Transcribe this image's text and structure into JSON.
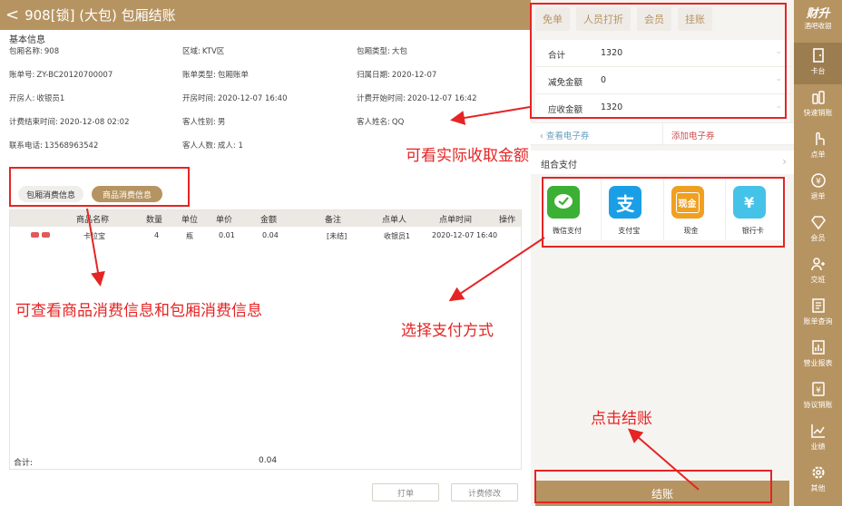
{
  "titlebar": {
    "back": "<",
    "title": "908[锁] (大包) 包厢结账"
  },
  "basic_info": {
    "section_title": "基本信息",
    "fields": [
      {
        "label": "包厢名称:",
        "value": "908"
      },
      {
        "label": "区域:",
        "value": "KTV区"
      },
      {
        "label": "包厢类型:",
        "value": "大包"
      },
      {
        "label": "账单号:",
        "value": "ZY-BC20120700007"
      },
      {
        "label": "账单类型:",
        "value": "包厢账单"
      },
      {
        "label": "归属日期:",
        "value": "2020-12-07"
      },
      {
        "label": "开房人:",
        "value": "收银员1"
      },
      {
        "label": "开房时间:",
        "value": "2020-12-07 16:40"
      },
      {
        "label": "计费开始时间:",
        "value": "2020-12-07 16:42"
      },
      {
        "label": "计费结束时间:",
        "value": "2020-12-08 02:02"
      },
      {
        "label": "客人性别:",
        "value": "男"
      },
      {
        "label": "客人姓名:",
        "value": "QQ"
      },
      {
        "label": "联系电话:",
        "value": "13568963542"
      },
      {
        "label": "客人人数:",
        "value": "成人: 1"
      }
    ]
  },
  "tabs": {
    "room": "包厢消费信息",
    "goods": "商品消费信息"
  },
  "table": {
    "headers": [
      "商品名称",
      "数量",
      "单位",
      "单价",
      "金额",
      "备注",
      "点单人",
      "点单时间",
      "操作"
    ],
    "rows": [
      [
        "卡拉宝",
        "4",
        "瓶",
        "0.01",
        "0.04",
        "[未结]",
        "收银员1",
        "2020-12-07 16:40",
        ""
      ]
    ],
    "sum_label": "合计:",
    "sum_value": "0.04"
  },
  "bottom_buttons": {
    "print": "打单",
    "modify": "计费修改"
  },
  "right": {
    "actions": [
      "免单",
      "人员打折",
      "会员",
      "挂账"
    ],
    "amounts": [
      {
        "label": "合计",
        "value": "1320"
      },
      {
        "label": "减免金额",
        "value": "0"
      },
      {
        "label": "应收金额",
        "value": "1320"
      }
    ],
    "coupon_view": "查看电子券",
    "coupon_add": "添加电子券",
    "combo_pay": "组合支付",
    "pay_methods": [
      {
        "label": "微信支付",
        "icon": "wechat-pay-icon",
        "color": "#3cb034"
      },
      {
        "label": "支付宝",
        "icon": "alipay-icon",
        "color": "#1a9fe6"
      },
      {
        "label": "现金",
        "icon": "cash-icon",
        "color": "#f0a020",
        "glyph": "现金"
      },
      {
        "label": "银行卡",
        "icon": "bank-card-icon",
        "color": "#45c2e8",
        "glyph": "¥"
      }
    ],
    "checkout": "结账"
  },
  "sidebar": {
    "brand_top": "财升",
    "brand_bottom": "酒吧收银",
    "items": [
      {
        "label": "卡台",
        "icon": "door-icon"
      },
      {
        "label": "快速销账",
        "icon": "bottle-icon"
      },
      {
        "label": "点单",
        "icon": "hand-icon"
      },
      {
        "label": "退单",
        "icon": "return-icon"
      },
      {
        "label": "会员",
        "icon": "diamond-icon"
      },
      {
        "label": "交班",
        "icon": "shift-icon"
      },
      {
        "label": "账单查询",
        "icon": "bill-icon"
      },
      {
        "label": "营业报表",
        "icon": "report-icon"
      },
      {
        "label": "协议销账",
        "icon": "agreement-icon"
      },
      {
        "label": "业绩",
        "icon": "chart-icon"
      },
      {
        "label": "其他",
        "icon": "gear-icon"
      }
    ]
  },
  "annotations": {
    "actual_amount": "可看实际收取金额",
    "consumption_info": "可查看商品消费信息和包厢消费信息",
    "choose_payment": "选择支付方式",
    "click_checkout": "点击结账"
  },
  "colors": {
    "gold": "#b69462",
    "annotation_red": "#e52424",
    "coupon_blue": "#6b9fbc"
  }
}
